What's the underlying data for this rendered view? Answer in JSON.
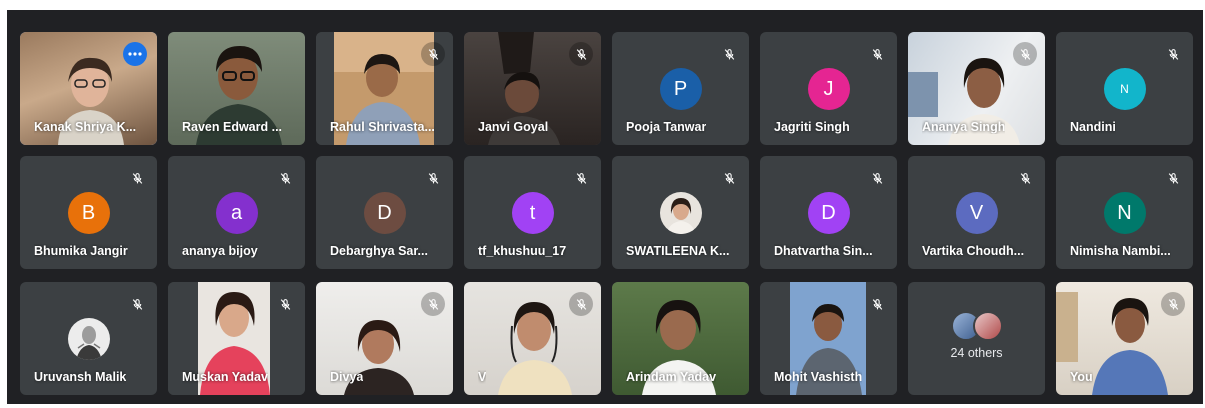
{
  "participants": [
    {
      "name": "Kanak Shriya K...",
      "avatar_color": "#5f6368",
      "initial": "",
      "muted": false,
      "more_options": true,
      "active": true
    },
    {
      "name": "Raven Edward ...",
      "avatar_color": "#5f6368",
      "initial": "",
      "muted": false,
      "more_options": false,
      "active": false
    },
    {
      "name": "Rahul Shrivasta...",
      "avatar_color": "#5f6368",
      "initial": "",
      "muted": true,
      "more_options": false,
      "active": false
    },
    {
      "name": "Janvi Goyal",
      "avatar_color": "#5f6368",
      "initial": "",
      "muted": true,
      "more_options": false,
      "active": false
    },
    {
      "name": "Pooja Tanwar",
      "avatar_color": "#1a5fa8",
      "initial": "P",
      "muted": true,
      "more_options": false,
      "active": false
    },
    {
      "name": "Jagriti Singh",
      "avatar_color": "#e52592",
      "initial": "J",
      "muted": true,
      "more_options": false,
      "active": false
    },
    {
      "name": "Ananya Singh",
      "avatar_color": "#5f6368",
      "initial": "",
      "muted": true,
      "more_options": false,
      "active": false
    },
    {
      "name": "Nandini",
      "avatar_color": "#12b5cb",
      "initial": "N",
      "muted": true,
      "more_options": false,
      "active": false
    },
    {
      "name": "Bhumika Jangir",
      "avatar_color": "#e8710a",
      "initial": "B",
      "muted": true,
      "more_options": false,
      "active": false
    },
    {
      "name": "ananya bijoy",
      "avatar_color": "#8430ce",
      "initial": "a",
      "muted": true,
      "more_options": false,
      "active": false
    },
    {
      "name": "Debarghya Sar...",
      "avatar_color": "#6d4c41",
      "initial": "D",
      "muted": true,
      "more_options": false,
      "active": false
    },
    {
      "name": "tf_khushuu_17",
      "avatar_color": "#a142f4",
      "initial": "t",
      "muted": true,
      "more_options": false,
      "active": false
    },
    {
      "name": "SWATILEENA K...",
      "avatar_color": "#5f6368",
      "initial": "",
      "muted": true,
      "more_options": false,
      "active": false
    },
    {
      "name": "Dhatvartha Sin...",
      "avatar_color": "#a142f4",
      "initial": "D",
      "muted": true,
      "more_options": false,
      "active": false
    },
    {
      "name": "Vartika Choudh...",
      "avatar_color": "#5c6bc0",
      "initial": "V",
      "muted": true,
      "more_options": false,
      "active": false
    },
    {
      "name": "Nimisha Nambi...",
      "avatar_color": "#00796b",
      "initial": "N",
      "muted": true,
      "more_options": false,
      "active": false
    },
    {
      "name": "Uruvansh Malik",
      "avatar_color": "#5f6368",
      "initial": "",
      "muted": true,
      "more_options": false,
      "active": false
    },
    {
      "name": "Muskan Yadav",
      "avatar_color": "#5f6368",
      "initial": "",
      "muted": true,
      "more_options": false,
      "active": false
    },
    {
      "name": "Divya",
      "avatar_color": "#5f6368",
      "initial": "",
      "muted": true,
      "more_options": false,
      "active": false
    },
    {
      "name": "V",
      "avatar_color": "#5f6368",
      "initial": "",
      "muted": true,
      "more_options": false,
      "active": false
    },
    {
      "name": "Arindam Yadav",
      "avatar_color": "#5f6368",
      "initial": "",
      "muted": false,
      "more_options": false,
      "active": false
    },
    {
      "name": "Mohit Vashisth",
      "avatar_color": "#5f6368",
      "initial": "",
      "muted": true,
      "more_options": false,
      "active": false
    },
    {
      "name": "24 others",
      "avatar_color": "#5f6368",
      "initial": "",
      "muted": false,
      "more_options": false,
      "active": false
    },
    {
      "name": "You",
      "avatar_color": "#5f6368",
      "initial": "",
      "muted": true,
      "more_options": false,
      "active": false
    }
  ],
  "others_label": "24 others",
  "colors": {
    "background": "#202124",
    "tile": "#3c4043",
    "active_border": "#8ab4f8",
    "more_button": "#1a73e8"
  },
  "icons": {
    "mute": "mic-off-icon",
    "more": "more-options-icon"
  }
}
